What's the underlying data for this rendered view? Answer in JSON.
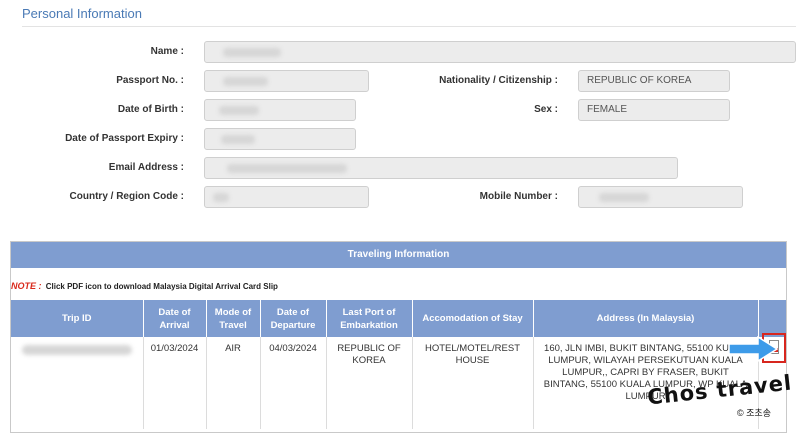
{
  "personal": {
    "title": "Personal Information",
    "name_label": "Name :",
    "passport_label": "Passport No. :",
    "nationality_label": "Nationality / Citizenship :",
    "nationality_value": "REPUBLIC OF KOREA",
    "dob_label": "Date of Birth :",
    "sex_label": "Sex :",
    "sex_value": "FEMALE",
    "expiry_label": "Date of Passport Expiry :",
    "email_label": "Email Address :",
    "country_label": "Country / Region Code :",
    "mobile_label": "Mobile Number :"
  },
  "travel": {
    "title": "Traveling Information",
    "note_prefix": "NOTE :",
    "note_text": "Click PDF icon to download Malaysia Digital Arrival Card Slip",
    "columns": [
      "Trip ID",
      "Date of Arrival",
      "Mode of Travel",
      "Date of Departure",
      "Last Port of Embarkation",
      "Accomodation of Stay",
      "Address (In Malaysia)",
      ""
    ],
    "row": {
      "arrival": "01/03/2024",
      "mode": "AIR",
      "departure": "04/03/2024",
      "port": "REPUBLIC OF KOREA",
      "accommodation": "HOTEL/MOTEL/REST HOUSE",
      "address": "160, JLN IMBI, BUKIT BINTANG, 55100 KUALA LUMPUR, WILAYAH PERSEKUTUAN KUALA LUMPUR,, CAPRI BY FRASER, BUKIT BINTANG, 55100 KUALA LUMPUR, WP KUALA LUMPUR"
    },
    "pdf_icon": "pdf-file-icon"
  },
  "watermark": {
    "text": "Chos travel",
    "sub": "© 조초송"
  },
  "colors": {
    "accent_title": "#4a7ab5",
    "table_header": "#7f9dd0",
    "note_red": "#d9291b",
    "highlight_red": "#d7261e",
    "arrow_blue": "#3d9be9"
  }
}
